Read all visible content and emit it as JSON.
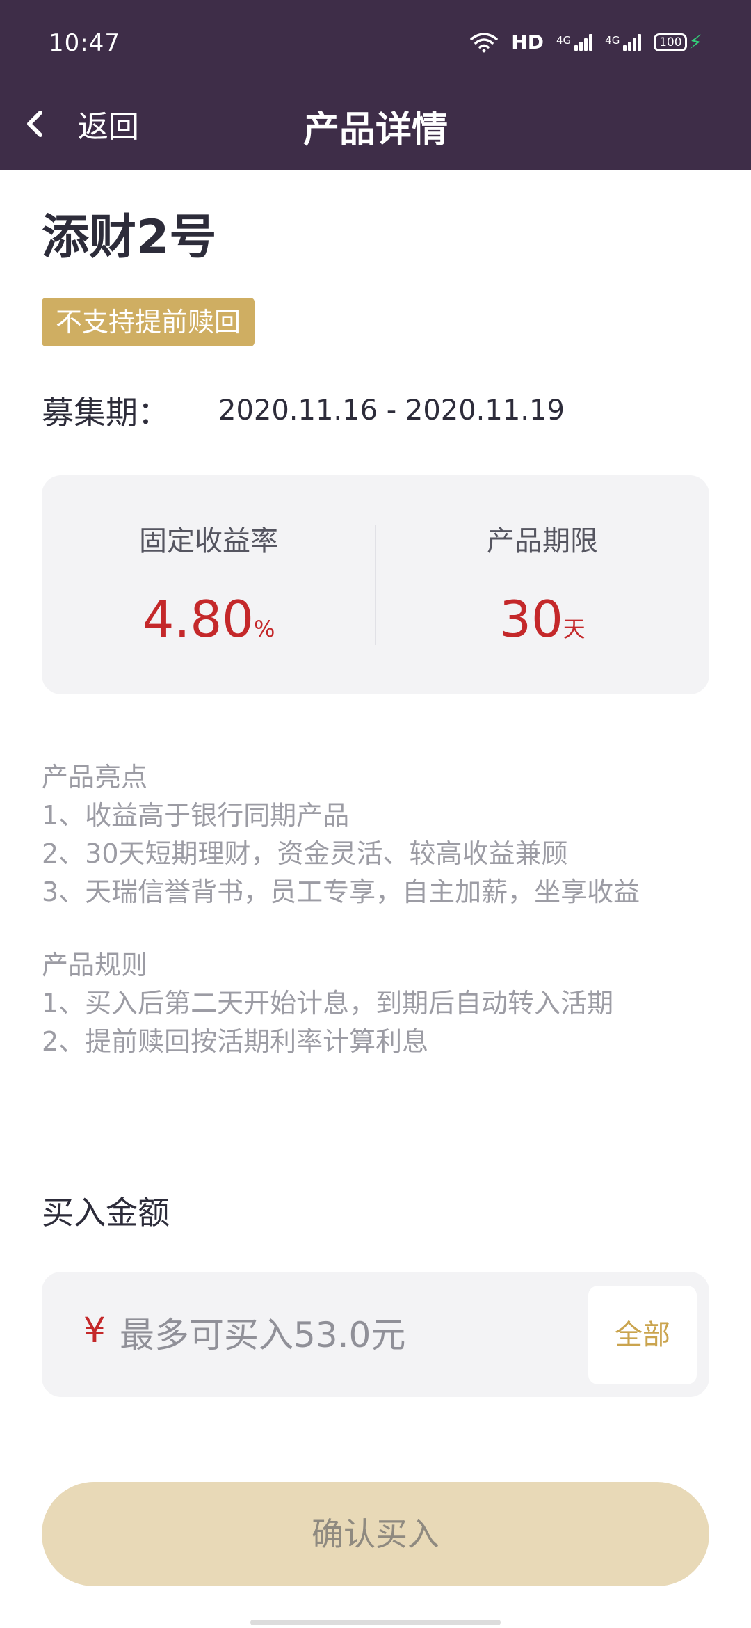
{
  "status_bar": {
    "time": "10:47",
    "network": "HD",
    "signal1": "4G",
    "signal2": "4G",
    "battery": "100",
    "icons": [
      "wifi-icon",
      "hd-icon",
      "signal-4g-icon",
      "signal-4g-icon",
      "battery-icon",
      "charging-icon"
    ]
  },
  "nav": {
    "back_icon": "chevron-left-icon",
    "back_label": "返回",
    "title": "产品详情"
  },
  "product": {
    "name": "添财2号",
    "tag": "不支持提前赎回",
    "period_label": "募集期：",
    "period_value": "2020.11.16 - 2020.11.19"
  },
  "stats": {
    "rate_label": "固定收益率",
    "rate_value": "4.80",
    "rate_unit": "%",
    "term_label": "产品期限",
    "term_value": "30",
    "term_unit": "天"
  },
  "highlights": {
    "title": "产品亮点",
    "lines": [
      "1、收益高于银行同期产品",
      "2、30天短期理财，资金灵活、较高收益兼顾",
      "3、天瑞信誉背书，员工专享，自主加薪，坐享收益"
    ]
  },
  "rules": {
    "title": "产品规则",
    "lines": [
      "1、买入后第二天开始计息，到期后自动转入活期",
      "2、提前赎回按活期利率计算利息"
    ]
  },
  "purchase": {
    "label": "买入金额",
    "currency": "¥",
    "value": "",
    "placeholder": "最多可买入53.0元",
    "all_label": "全部",
    "confirm_label": "确认买入"
  },
  "colors": {
    "header_bg": "#3e2d48",
    "accent_red": "#c4282a",
    "gold": "#cfae62",
    "confirm_bg": "#e8d9b7"
  }
}
